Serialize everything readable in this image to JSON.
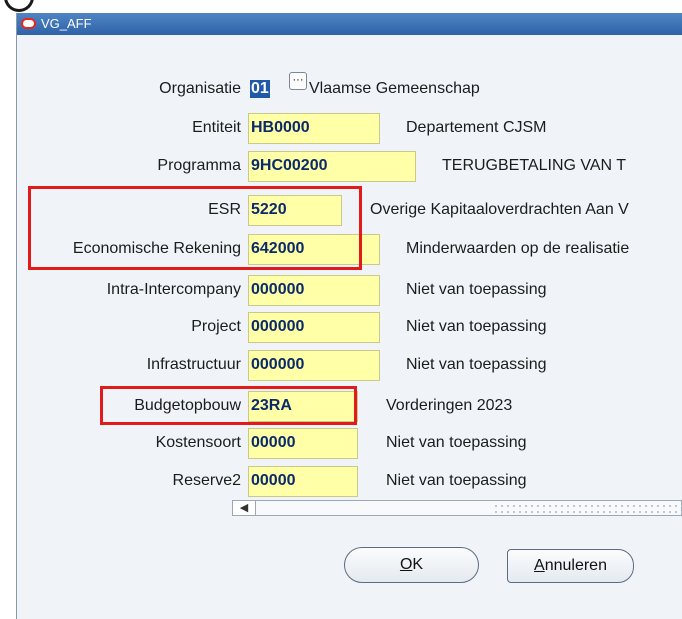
{
  "window": {
    "title": "VG_AFF"
  },
  "form": {
    "rows": [
      {
        "label": "Organisatie",
        "value": "01",
        "description": "Vlaamse Gemeenschap"
      },
      {
        "label": "Entiteit",
        "value": "HB0000",
        "description": "Departement CJSM"
      },
      {
        "label": "Programma",
        "value": "9HC00200",
        "description": "TERUGBETALING VAN T"
      },
      {
        "label": "ESR",
        "value": "5220",
        "description": "Overige Kapitaaloverdrachten Aan V"
      },
      {
        "label": "Economische Rekening",
        "value": "642000",
        "description": "Minderwaarden op de realisatie"
      },
      {
        "label": "Intra-Intercompany",
        "value": "000000",
        "description": "Niet van toepassing"
      },
      {
        "label": "Project",
        "value": "000000",
        "description": "Niet van toepassing"
      },
      {
        "label": "Infrastructuur",
        "value": "000000",
        "description": "Niet van toepassing"
      },
      {
        "label": "Budgetopbouw",
        "value": "23RA",
        "description": "Vorderingen 2023"
      },
      {
        "label": "Kostensoort",
        "value": "00000",
        "description": "Niet van toepassing"
      },
      {
        "label": "Reserve2",
        "value": "00000",
        "description": "Niet van toepassing"
      }
    ]
  },
  "buttons": {
    "ok_mnemonic": "O",
    "ok_rest": "K",
    "cancel_mnemonic": "A",
    "cancel_rest": "nnuleren",
    "lov_glyph": "···"
  },
  "icons": {
    "app_logo": "oracle-logo-icon",
    "scroll_left": "arrow-left-icon",
    "lov": "ellipsis-icon"
  },
  "colors": {
    "titlebar": "#3a70b6",
    "field_bg": "#ffffa8",
    "highlight_box": "#e11a1a",
    "value_text": "#0a2a6a"
  }
}
